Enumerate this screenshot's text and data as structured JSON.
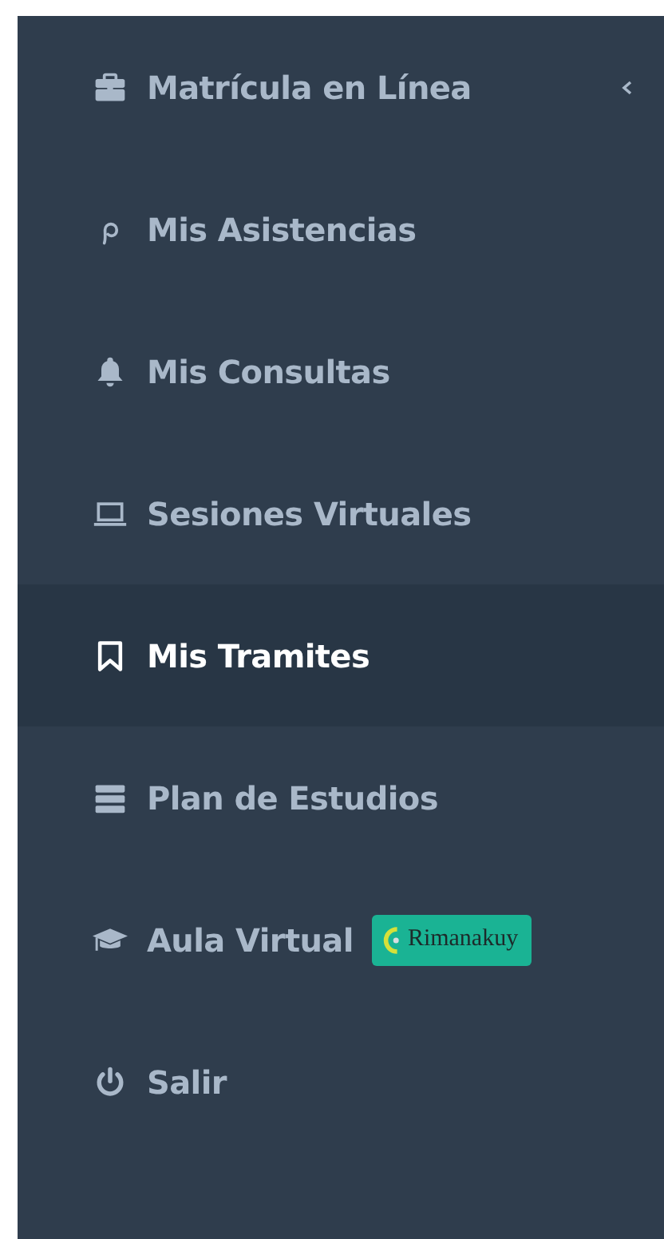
{
  "menu": {
    "items": [
      {
        "label": "Matrícula en Línea",
        "selected": false,
        "expanded": false
      },
      {
        "label": "Mis Asistencias",
        "selected": false
      },
      {
        "label": "Mis Consultas",
        "selected": false
      },
      {
        "label": "Sesiones Virtuales",
        "selected": false
      },
      {
        "label": "Mis Tramites",
        "selected": true
      },
      {
        "label": "Plan de Estudios",
        "selected": false
      },
      {
        "label": "Aula Virtual",
        "selected": false,
        "badge": "Rimanakuy"
      },
      {
        "label": "Salir",
        "selected": false
      }
    ]
  }
}
